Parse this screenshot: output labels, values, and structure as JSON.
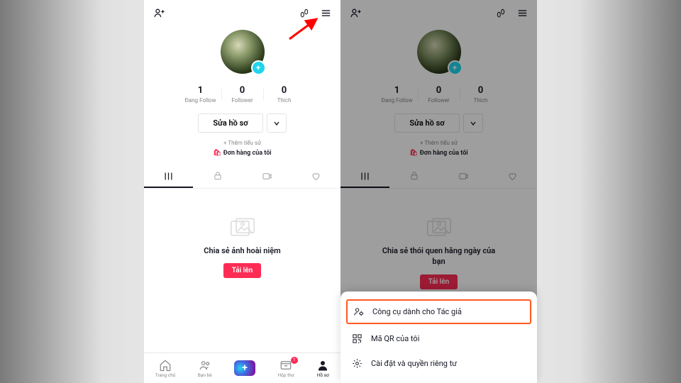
{
  "profile": {
    "following": {
      "count": "1",
      "label": "Đang Follow"
    },
    "followers": {
      "count": "0",
      "label": "Follower"
    },
    "likes": {
      "count": "0",
      "label": "Thích"
    },
    "edit_btn": "Sửa hồ sơ",
    "add_bio": "+ Thêm tiểu sử",
    "orders": "Đơn hàng của tôi"
  },
  "empty1": {
    "title": "Chia sẻ ảnh hoài niệm",
    "btn": "Tải lên"
  },
  "empty2": {
    "title": "Chia sẻ thói quen hằng ngày của bạn",
    "btn": "Tải lên"
  },
  "bottom": {
    "home": "Trang chủ",
    "friends": "Bạn bè",
    "inbox": "Hộp thư",
    "inbox_badge": "1",
    "profile": "Hồ sơ"
  },
  "menu": {
    "creator": "Công cụ dành cho Tác giả",
    "qr": "Mã QR của tôi",
    "settings": "Cài đặt và quyền riêng tư"
  }
}
